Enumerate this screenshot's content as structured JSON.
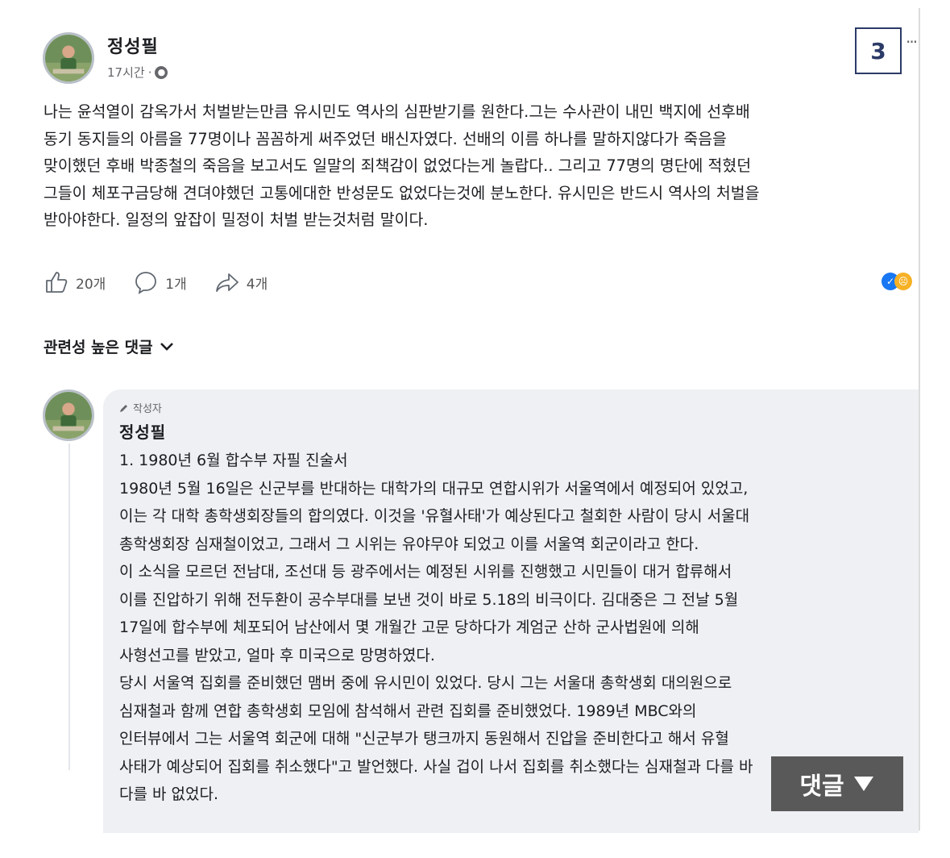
{
  "post": {
    "author": "정성필",
    "time": "17시간",
    "separator": "·",
    "globe_icon": "globe-icon",
    "body": "나는 윤석열이 감옥가서 처벌받는만큼 유시민도 역사의 심판받기를 원한다.그는 수사관이 내민 백지에 선후배\n동기 동지들의 아름을 77명이나 꼼꼼하게 써주었던 배신자였다.  선배의 이름 하나를 말하지않다가 죽음을\n맞이했던 후배 박종철의 죽음을 보고서도 일말의 죄책감이 없었다는게 놀랍다.. 그리고 77명의 명단에 적혔던\n그들이 체포구금당해 견뎌야했던 고통에대한 반성문도 없었다는것에  분노한다. 유시민은 반드시 역사의 처벌을\n받아야한다. 일정의 앞잡이 밀정이 처벌 받는것처럼 말이다.",
    "likes": "20개",
    "comments": "1개",
    "shares": "4개"
  },
  "badge_number": "3",
  "sort_label": "관련성 높은 댓글",
  "comment": {
    "author_tag": "작성자",
    "author": "정성필",
    "body": "1. 1980년 6월 합수부 자필 진술서\n1980년 5월 16일은 신군부를 반대하는 대학가의 대규모 연합시위가 서울역에서 예정되어 있었고,\n이는 각 대학 총학생회장들의 합의였다. 이것을 '유혈사태'가 예상된다고 철회한 사람이 당시 서울대\n총학생회장 심재철이었고, 그래서 그 시위는 유야무야 되었고 이를 서울역 회군이라고 한다.\n이 소식을 모르던 전남대, 조선대 등 광주에서는 예정된 시위를 진행했고 시민들이 대거 합류해서\n이를 진압하기 위해 전두환이 공수부대를 보낸 것이 바로 5.18의 비극이다. 김대중은 그 전날 5월\n17일에 합수부에 체포되어 남산에서 몇 개월간 고문 당하다가 계엄군 산하 군사법원에 의해\n사형선고를 받았고, 얼마 후 미국으로 망명하였다.\n당시 서울역 집회를 준비했던 맴버 중에 유시민이 있었다. 당시 그는 서울대 총학생회 대의원으로\n심재철과 함께 연합 총학생회 모임에 참석해서 관련 집회를 준비했었다. 1989년 MBC와의\n인터뷰에서 그는 서울역 회군에 대해 \"신군부가 탱크까지 동원해서 진압을 준비한다고 해서 유혈\n사태가 예상되어 집회를 취소했다\"고 발언했다. 사실 겁이 나서 집회를 취소했다는 심재철과 다를 바\n다를 바 없었다."
  },
  "overlay_button": "댓글"
}
